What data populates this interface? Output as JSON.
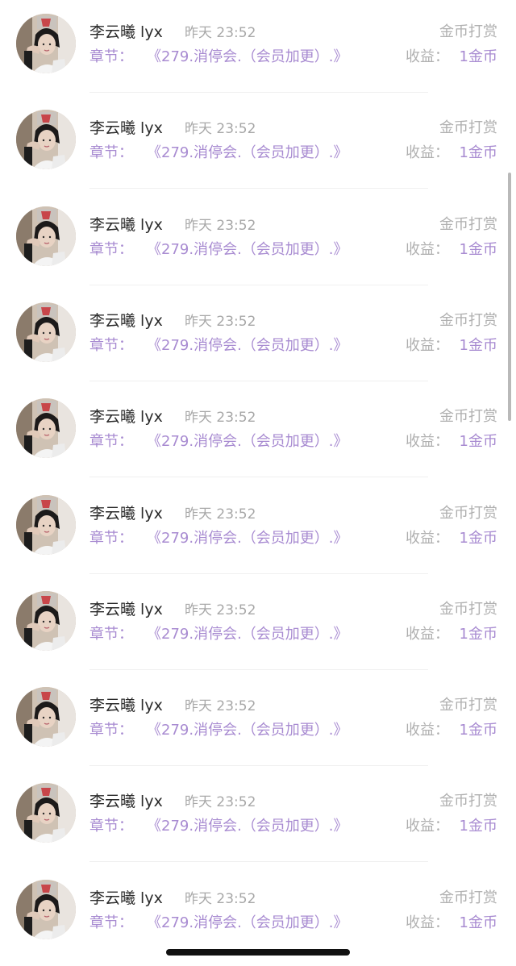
{
  "records": [
    {
      "user_name": "李云曦 lyx",
      "time": "昨天 23:52",
      "type": "金币打赏",
      "chapter_label": "章节：",
      "chapter_title": "《279.消停会.（会员加更）.》",
      "income_label": "收益：",
      "income_value": "1金币",
      "avatar": "user-avatar-photo"
    },
    {
      "user_name": "李云曦 lyx",
      "time": "昨天 23:52",
      "type": "金币打赏",
      "chapter_label": "章节：",
      "chapter_title": "《279.消停会.（会员加更）.》",
      "income_label": "收益：",
      "income_value": "1金币",
      "avatar": "user-avatar-photo"
    },
    {
      "user_name": "李云曦 lyx",
      "time": "昨天 23:52",
      "type": "金币打赏",
      "chapter_label": "章节：",
      "chapter_title": "《279.消停会.（会员加更）.》",
      "income_label": "收益：",
      "income_value": "1金币",
      "avatar": "user-avatar-photo"
    },
    {
      "user_name": "李云曦 lyx",
      "time": "昨天 23:52",
      "type": "金币打赏",
      "chapter_label": "章节：",
      "chapter_title": "《279.消停会.（会员加更）.》",
      "income_label": "收益：",
      "income_value": "1金币",
      "avatar": "user-avatar-photo"
    },
    {
      "user_name": "李云曦 lyx",
      "time": "昨天 23:52",
      "type": "金币打赏",
      "chapter_label": "章节：",
      "chapter_title": "《279.消停会.（会员加更）.》",
      "income_label": "收益：",
      "income_value": "1金币",
      "avatar": "user-avatar-photo"
    },
    {
      "user_name": "李云曦 lyx",
      "time": "昨天 23:52",
      "type": "金币打赏",
      "chapter_label": "章节：",
      "chapter_title": "《279.消停会.（会员加更）.》",
      "income_label": "收益：",
      "income_value": "1金币",
      "avatar": "user-avatar-photo"
    },
    {
      "user_name": "李云曦 lyx",
      "time": "昨天 23:52",
      "type": "金币打赏",
      "chapter_label": "章节：",
      "chapter_title": "《279.消停会.（会员加更）.》",
      "income_label": "收益：",
      "income_value": "1金币",
      "avatar": "user-avatar-photo"
    },
    {
      "user_name": "李云曦 lyx",
      "time": "昨天 23:52",
      "type": "金币打赏",
      "chapter_label": "章节：",
      "chapter_title": "《279.消停会.（会员加更）.》",
      "income_label": "收益：",
      "income_value": "1金币",
      "avatar": "user-avatar-photo"
    },
    {
      "user_name": "李云曦 lyx",
      "time": "昨天 23:52",
      "type": "金币打赏",
      "chapter_label": "章节：",
      "chapter_title": "《279.消停会.（会员加更）.》",
      "income_label": "收益：",
      "income_value": "1金币",
      "avatar": "user-avatar-photo"
    },
    {
      "user_name": "李云曦 lyx",
      "time": "昨天 23:52",
      "type": "金币打赏",
      "chapter_label": "章节：",
      "chapter_title": "《279.消停会.（会员加更）.》",
      "income_label": "收益：",
      "income_value": "1金币",
      "avatar": "user-avatar-photo"
    }
  ],
  "colors": {
    "accent_purple": "#a88bd1",
    "muted_gray": "#b0b0b0",
    "name_text": "#2a2a2a",
    "divider": "#f0f0f0"
  }
}
